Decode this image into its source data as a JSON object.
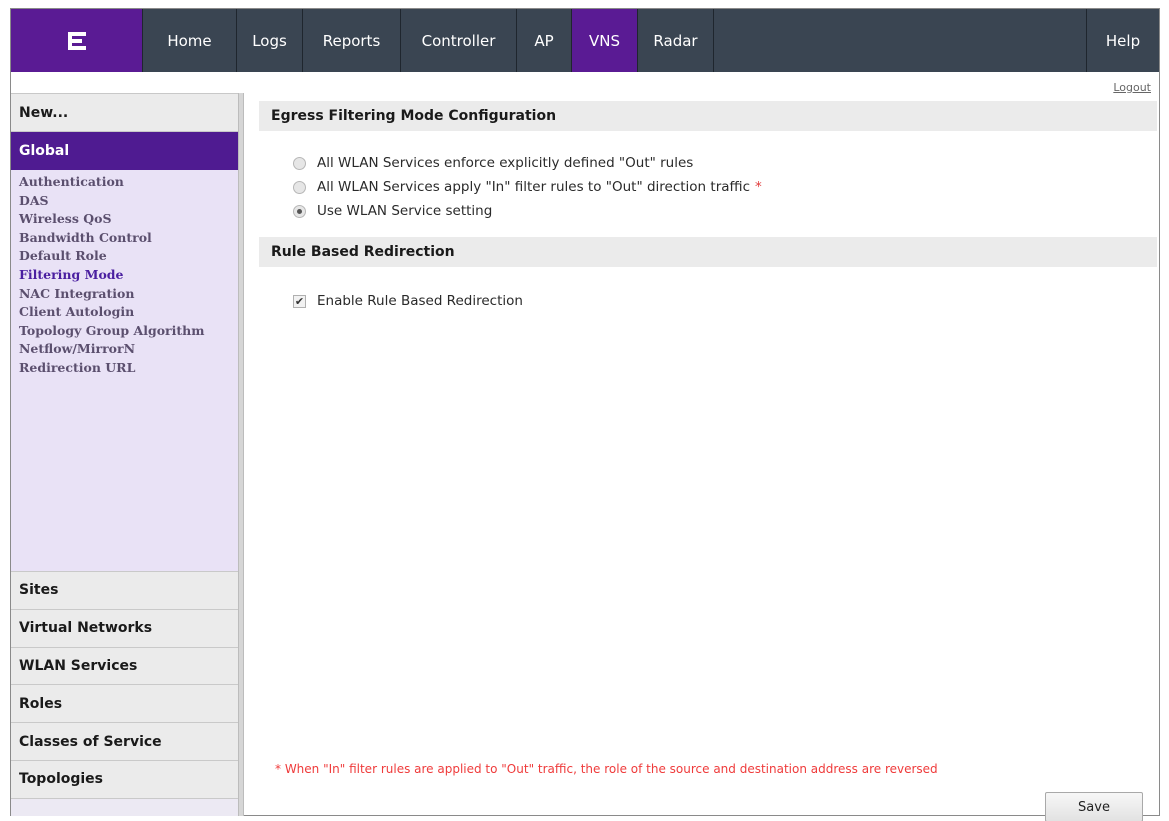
{
  "nav": {
    "logo_icon": "extreme-networks-logo-icon",
    "items": [
      "Home",
      "Logs",
      "Reports",
      "Controller",
      "AP",
      "VNS",
      "Radar"
    ],
    "active": "VNS",
    "help": "Help",
    "active_color": "#5a1b94",
    "bar_color": "#3a4552"
  },
  "logout": "Logout",
  "sidebar": {
    "new_label": "New...",
    "global_label": "Global",
    "sub_items": [
      "Authentication",
      "DAS",
      "Wireless QoS",
      "Bandwidth Control",
      "Default Role",
      "Filtering Mode",
      "NAC Integration",
      "Client Autologin",
      "Topology Group Algorithm",
      "Netflow/MirrorN",
      "Redirection URL"
    ],
    "active_sub": "Filtering Mode",
    "bottom_items": [
      "Sites",
      "Virtual Networks",
      "WLAN Services",
      "Roles",
      "Classes of Service",
      "Topologies"
    ]
  },
  "main": {
    "egress_title": "Egress Filtering Mode Configuration",
    "radio_options": [
      {
        "label": "All WLAN Services enforce explicitly defined \"Out\" rules",
        "checked": false,
        "required": false
      },
      {
        "label": "All WLAN Services apply \"In\" filter rules to \"Out\" direction traffic",
        "checked": false,
        "required": true
      },
      {
        "label": "Use WLAN Service setting",
        "checked": true,
        "required": false
      }
    ],
    "required_mark": "*",
    "redirect_title": "Rule Based Redirection",
    "redirect_checkbox_label": "Enable Rule Based Redirection",
    "redirect_checked": true,
    "footnote": "* When \"In\" filter rules are applied to \"Out\" traffic, the role of the source and destination address are reversed",
    "save_label": "Save"
  }
}
